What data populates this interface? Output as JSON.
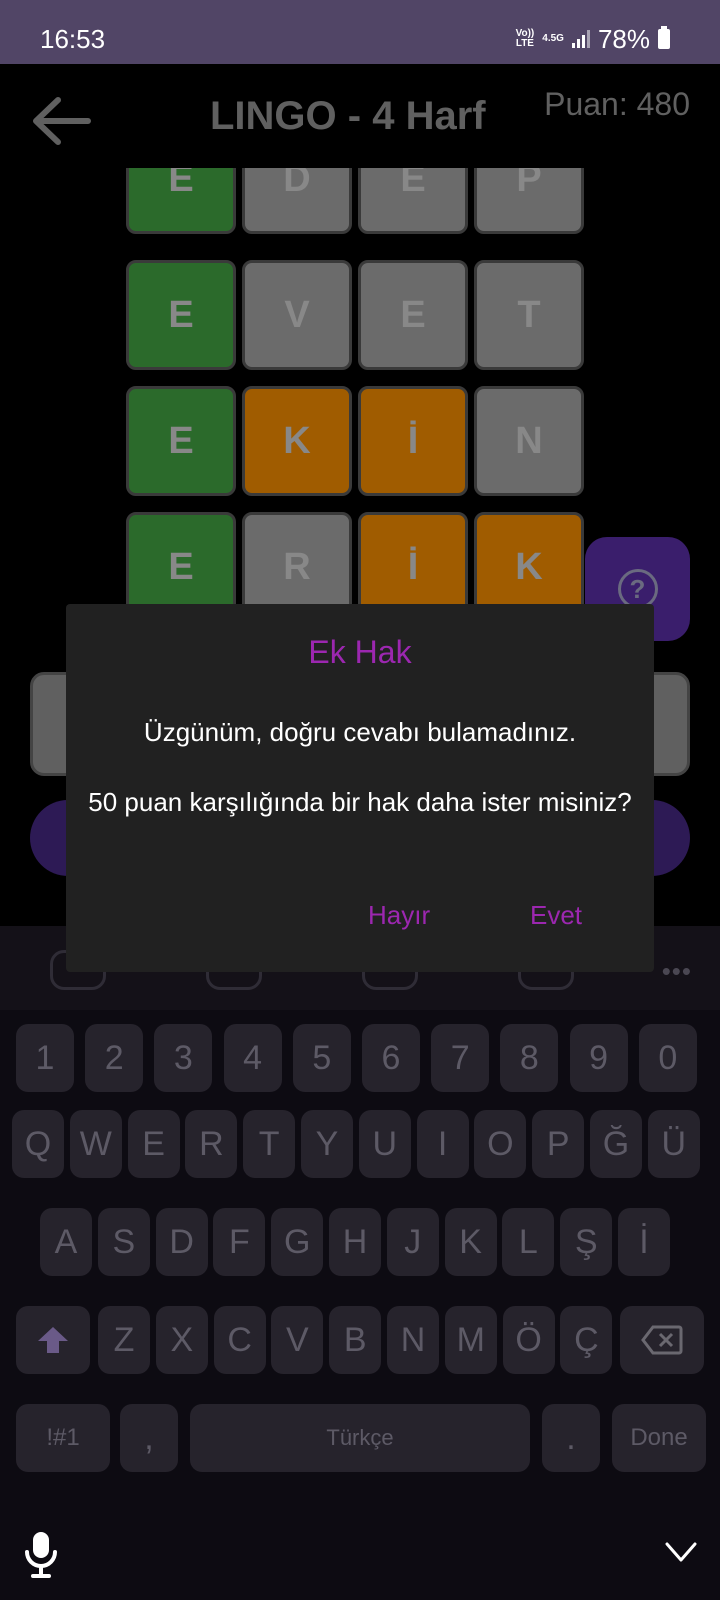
{
  "status_bar": {
    "time": "16:53",
    "network_top": "Vo))",
    "network_bottom": "LTE",
    "network_type": "4.5G",
    "battery": "78%"
  },
  "header": {
    "title": "LINGO - 4 Harf",
    "score": "Puan: 480",
    "back_icon": "arrow-left-icon"
  },
  "board": {
    "rows": [
      [
        {
          "letter": "E",
          "state": "green"
        },
        {
          "letter": "D",
          "state": "gray"
        },
        {
          "letter": "E",
          "state": "gray"
        },
        {
          "letter": "P",
          "state": "gray"
        }
      ],
      [
        {
          "letter": "E",
          "state": "green"
        },
        {
          "letter": "V",
          "state": "gray"
        },
        {
          "letter": "E",
          "state": "gray"
        },
        {
          "letter": "T",
          "state": "gray"
        }
      ],
      [
        {
          "letter": "E",
          "state": "green"
        },
        {
          "letter": "K",
          "state": "orange"
        },
        {
          "letter": "İ",
          "state": "orange"
        },
        {
          "letter": "N",
          "state": "gray"
        }
      ],
      [
        {
          "letter": "E",
          "state": "green"
        },
        {
          "letter": "R",
          "state": "gray"
        },
        {
          "letter": "İ",
          "state": "orange"
        },
        {
          "letter": "K",
          "state": "orange"
        }
      ]
    ],
    "help_label": "?"
  },
  "dialog": {
    "title": "Ek Hak",
    "message": "Üzgünüm, doğru cevabı bulamadınız.",
    "question": "50 puan karşılığında bir hak daha ister misiniz?",
    "no_label": "Hayır",
    "yes_label": "Evet"
  },
  "keyboard": {
    "row_numbers": [
      "1",
      "2",
      "3",
      "4",
      "5",
      "6",
      "7",
      "8",
      "9",
      "0"
    ],
    "row_q": [
      "Q",
      "W",
      "E",
      "R",
      "T",
      "Y",
      "U",
      "I",
      "O",
      "P",
      "Ğ",
      "Ü"
    ],
    "row_a": [
      "A",
      "S",
      "D",
      "F",
      "G",
      "H",
      "J",
      "K",
      "L",
      "Ş",
      "İ"
    ],
    "row_z": [
      "Z",
      "X",
      "C",
      "V",
      "B",
      "N",
      "M",
      "Ö",
      "Ç"
    ],
    "symbols_label": "!#1",
    "comma_label": ",",
    "space_label": "Türkçe",
    "period_label": ".",
    "done_label": "Done"
  },
  "colors": {
    "green": "#2b6a2b",
    "gray": "#6b6b6b",
    "orange": "#a05c00",
    "accent": "#9c27b0",
    "status_bar": "#514566"
  }
}
